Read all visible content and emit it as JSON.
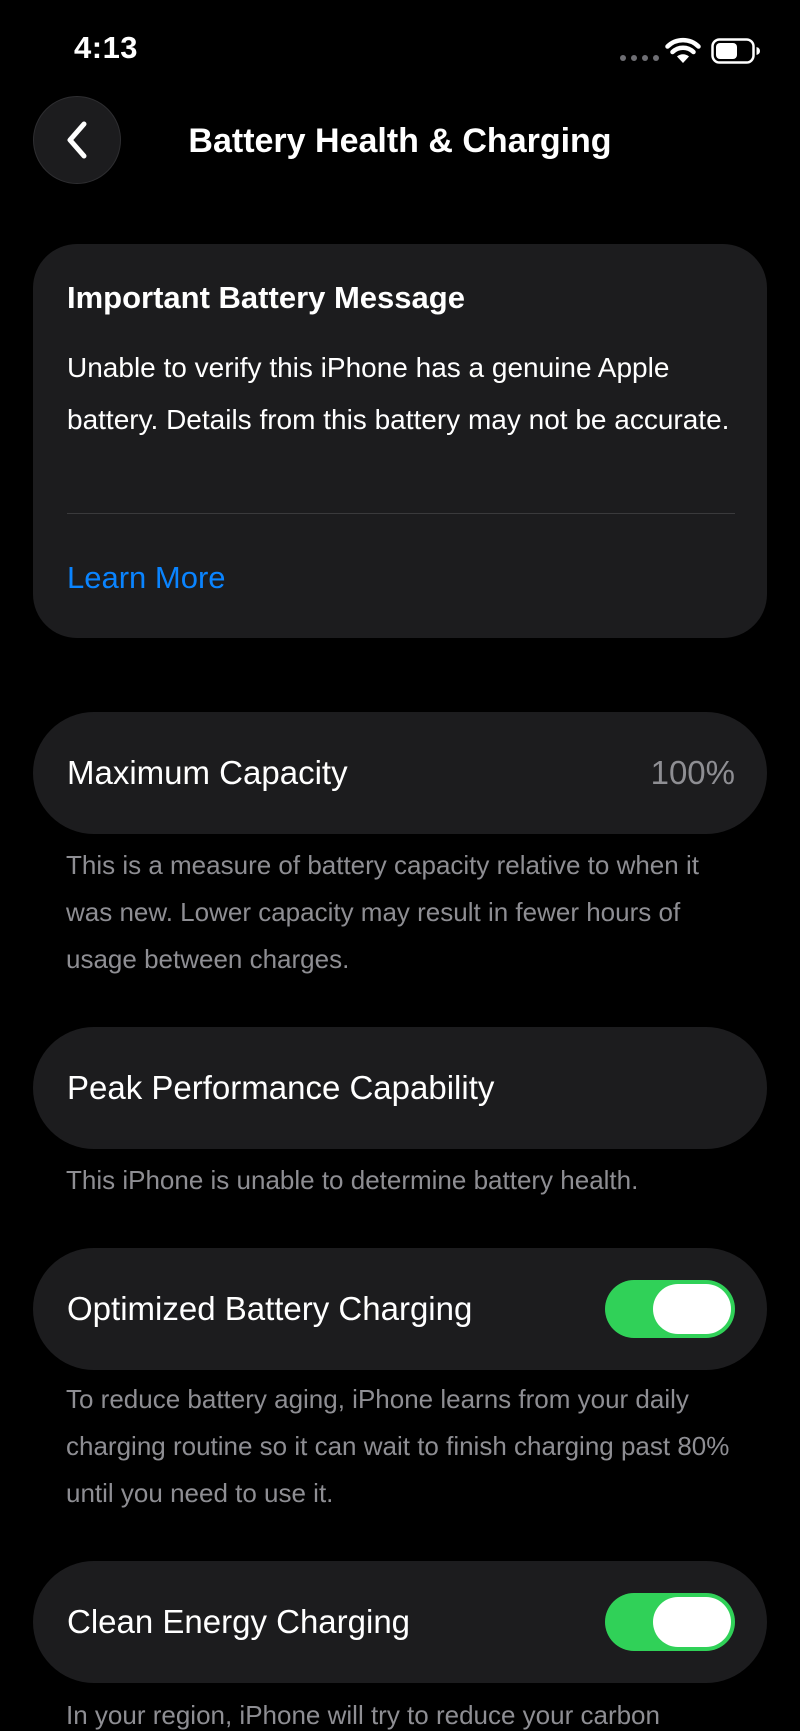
{
  "status_bar": {
    "time": "4:13",
    "icons": [
      "signal-dots-icon",
      "wifi-icon",
      "battery-icon"
    ]
  },
  "nav": {
    "title": "Battery Health & Charging",
    "back_icon": "chevron-left-icon"
  },
  "message": {
    "heading": "Important Battery Message",
    "body": "Unable to verify this iPhone has a genuine Apple battery. Details from this battery may not be accurate.",
    "link": "Learn More"
  },
  "maximum_capacity": {
    "label": "Maximum Capacity",
    "value": "100%",
    "footer": "This is a measure of battery capacity relative to when it was new. Lower capacity may result in fewer hours of usage between charges."
  },
  "peak_performance": {
    "label": "Peak Performance Capability",
    "footer": "This iPhone is unable to determine battery health."
  },
  "optimized_charging": {
    "label": "Optimized Battery Charging",
    "enabled": true,
    "footer": "To reduce battery aging, iPhone learns from your daily charging routine so it can wait to finish charging past 80% until you need to use it."
  },
  "clean_energy": {
    "label": "Clean Energy Charging",
    "enabled": true,
    "footer": "In your region, iPhone will try to reduce your carbon"
  },
  "colors": {
    "background": "#000000",
    "card": "#1c1c1e",
    "link": "#0a84ff",
    "toggle_on": "#30d158",
    "secondary_text": "#8e8e93"
  }
}
